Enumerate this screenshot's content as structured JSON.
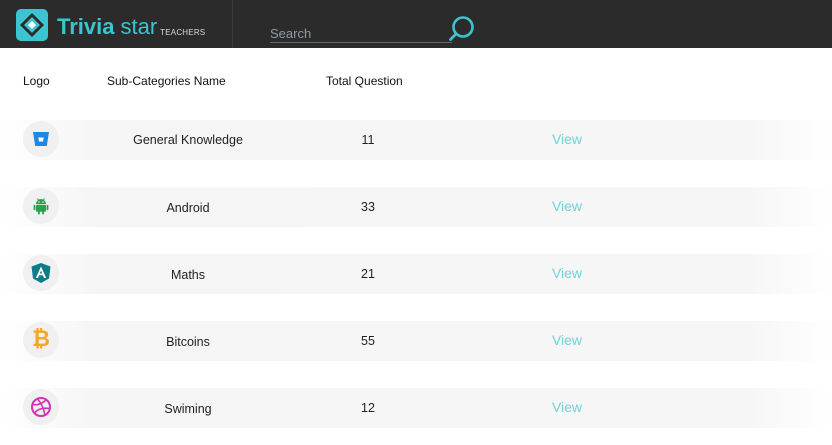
{
  "brand": {
    "name_bold": "Trivia",
    "name_light": "star",
    "subtitle": "TEACHERS"
  },
  "search": {
    "placeholder": "Search"
  },
  "table": {
    "headers": {
      "logo": "Logo",
      "name": "Sub-Categories Name",
      "total": "Total Question"
    },
    "rows": [
      {
        "icon": "bitbucket-icon",
        "icon_color": "#1e88e5",
        "name": "General Knowledge",
        "total": "11",
        "action": "View"
      },
      {
        "icon": "android-icon",
        "icon_color": "#2e9e4f",
        "name": "Android",
        "total": "33",
        "action": "View"
      },
      {
        "icon": "angular-icon",
        "icon_color": "#0d7c86",
        "name": "Maths",
        "total": "21",
        "action": "View"
      },
      {
        "icon": "bitcoin-icon",
        "icon_color": "#f5a623",
        "name": "Bitcoins",
        "total": "55",
        "action": "View"
      },
      {
        "icon": "dribbble-icon",
        "icon_color": "#d433b4",
        "name": "Swiming",
        "total": "12",
        "action": "View"
      }
    ]
  },
  "colors": {
    "accent": "#3cc4d1",
    "view_link": "#6fd3da",
    "topbar": "#2b2b2b"
  }
}
